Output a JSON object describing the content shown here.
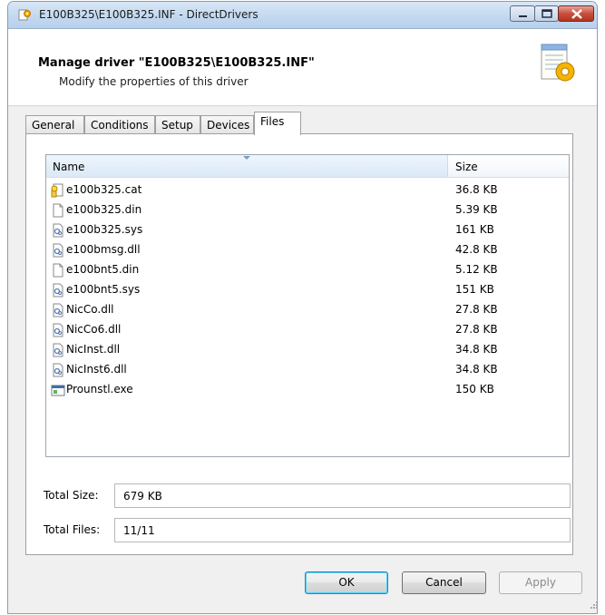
{
  "window": {
    "title": "E100B325\\E100B325.INF - DirectDrivers",
    "icon": "app-gear-icon"
  },
  "header": {
    "title": "Manage driver \"E100B325\\E100B325.INF\"",
    "subtitle": "Modify the properties of this driver",
    "icon": "document-gear-icon"
  },
  "tabs": [
    {
      "label": "General"
    },
    {
      "label": "Conditions"
    },
    {
      "label": "Setup"
    },
    {
      "label": "Devices"
    },
    {
      "label": "Files",
      "active": true
    }
  ],
  "files": {
    "columns": {
      "name": "Name",
      "size": "Size"
    },
    "rows": [
      {
        "name": "e100b325.cat",
        "size": "36.8 KB",
        "icon": "catalog-icon"
      },
      {
        "name": "e100b325.din",
        "size": "5.39 KB",
        "icon": "blank-file-icon"
      },
      {
        "name": "e100b325.sys",
        "size": "161 KB",
        "icon": "system-file-icon"
      },
      {
        "name": "e100bmsg.dll",
        "size": "42.8 KB",
        "icon": "system-file-icon"
      },
      {
        "name": "e100bnt5.din",
        "size": "5.12 KB",
        "icon": "blank-file-icon"
      },
      {
        "name": "e100bnt5.sys",
        "size": "151 KB",
        "icon": "system-file-icon"
      },
      {
        "name": "NicCo.dll",
        "size": "27.8 KB",
        "icon": "system-file-icon"
      },
      {
        "name": "NicCo6.dll",
        "size": "27.8 KB",
        "icon": "system-file-icon"
      },
      {
        "name": "NicInst.dll",
        "size": "34.8 KB",
        "icon": "system-file-icon"
      },
      {
        "name": "NicInst6.dll",
        "size": "34.8 KB",
        "icon": "system-file-icon"
      },
      {
        "name": "Prounstl.exe",
        "size": "150 KB",
        "icon": "executable-icon"
      }
    ]
  },
  "totals": {
    "size_label": "Total Size:",
    "size_value": "679 KB",
    "files_label": "Total Files:",
    "files_value": "11/11"
  },
  "buttons": {
    "ok": "OK",
    "cancel": "Cancel",
    "apply": "Apply"
  },
  "colors": {
    "accent": "#3c7fb1",
    "close_button": "#c8503d"
  }
}
